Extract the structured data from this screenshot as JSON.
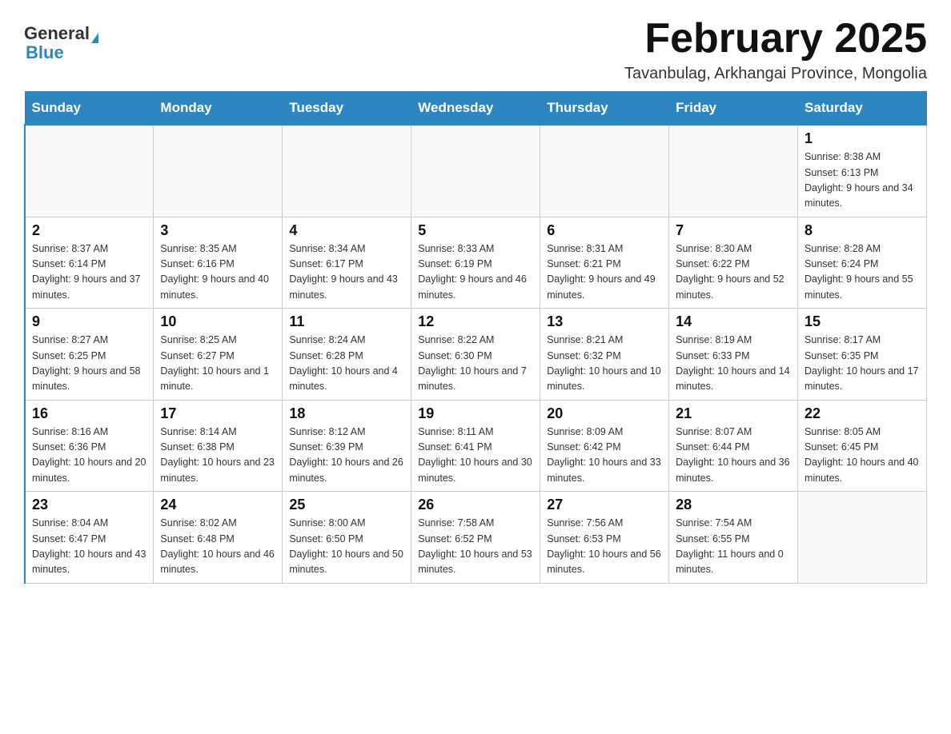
{
  "header": {
    "logo_general": "General",
    "logo_blue": "Blue",
    "title": "February 2025",
    "subtitle": "Tavanbulag, Arkhangai Province, Mongolia"
  },
  "calendar": {
    "days_of_week": [
      "Sunday",
      "Monday",
      "Tuesday",
      "Wednesday",
      "Thursday",
      "Friday",
      "Saturday"
    ],
    "weeks": [
      [
        {
          "day": "",
          "info": ""
        },
        {
          "day": "",
          "info": ""
        },
        {
          "day": "",
          "info": ""
        },
        {
          "day": "",
          "info": ""
        },
        {
          "day": "",
          "info": ""
        },
        {
          "day": "",
          "info": ""
        },
        {
          "day": "1",
          "info": "Sunrise: 8:38 AM\nSunset: 6:13 PM\nDaylight: 9 hours and 34 minutes."
        }
      ],
      [
        {
          "day": "2",
          "info": "Sunrise: 8:37 AM\nSunset: 6:14 PM\nDaylight: 9 hours and 37 minutes."
        },
        {
          "day": "3",
          "info": "Sunrise: 8:35 AM\nSunset: 6:16 PM\nDaylight: 9 hours and 40 minutes."
        },
        {
          "day": "4",
          "info": "Sunrise: 8:34 AM\nSunset: 6:17 PM\nDaylight: 9 hours and 43 minutes."
        },
        {
          "day": "5",
          "info": "Sunrise: 8:33 AM\nSunset: 6:19 PM\nDaylight: 9 hours and 46 minutes."
        },
        {
          "day": "6",
          "info": "Sunrise: 8:31 AM\nSunset: 6:21 PM\nDaylight: 9 hours and 49 minutes."
        },
        {
          "day": "7",
          "info": "Sunrise: 8:30 AM\nSunset: 6:22 PM\nDaylight: 9 hours and 52 minutes."
        },
        {
          "day": "8",
          "info": "Sunrise: 8:28 AM\nSunset: 6:24 PM\nDaylight: 9 hours and 55 minutes."
        }
      ],
      [
        {
          "day": "9",
          "info": "Sunrise: 8:27 AM\nSunset: 6:25 PM\nDaylight: 9 hours and 58 minutes."
        },
        {
          "day": "10",
          "info": "Sunrise: 8:25 AM\nSunset: 6:27 PM\nDaylight: 10 hours and 1 minute."
        },
        {
          "day": "11",
          "info": "Sunrise: 8:24 AM\nSunset: 6:28 PM\nDaylight: 10 hours and 4 minutes."
        },
        {
          "day": "12",
          "info": "Sunrise: 8:22 AM\nSunset: 6:30 PM\nDaylight: 10 hours and 7 minutes."
        },
        {
          "day": "13",
          "info": "Sunrise: 8:21 AM\nSunset: 6:32 PM\nDaylight: 10 hours and 10 minutes."
        },
        {
          "day": "14",
          "info": "Sunrise: 8:19 AM\nSunset: 6:33 PM\nDaylight: 10 hours and 14 minutes."
        },
        {
          "day": "15",
          "info": "Sunrise: 8:17 AM\nSunset: 6:35 PM\nDaylight: 10 hours and 17 minutes."
        }
      ],
      [
        {
          "day": "16",
          "info": "Sunrise: 8:16 AM\nSunset: 6:36 PM\nDaylight: 10 hours and 20 minutes."
        },
        {
          "day": "17",
          "info": "Sunrise: 8:14 AM\nSunset: 6:38 PM\nDaylight: 10 hours and 23 minutes."
        },
        {
          "day": "18",
          "info": "Sunrise: 8:12 AM\nSunset: 6:39 PM\nDaylight: 10 hours and 26 minutes."
        },
        {
          "day": "19",
          "info": "Sunrise: 8:11 AM\nSunset: 6:41 PM\nDaylight: 10 hours and 30 minutes."
        },
        {
          "day": "20",
          "info": "Sunrise: 8:09 AM\nSunset: 6:42 PM\nDaylight: 10 hours and 33 minutes."
        },
        {
          "day": "21",
          "info": "Sunrise: 8:07 AM\nSunset: 6:44 PM\nDaylight: 10 hours and 36 minutes."
        },
        {
          "day": "22",
          "info": "Sunrise: 8:05 AM\nSunset: 6:45 PM\nDaylight: 10 hours and 40 minutes."
        }
      ],
      [
        {
          "day": "23",
          "info": "Sunrise: 8:04 AM\nSunset: 6:47 PM\nDaylight: 10 hours and 43 minutes."
        },
        {
          "day": "24",
          "info": "Sunrise: 8:02 AM\nSunset: 6:48 PM\nDaylight: 10 hours and 46 minutes."
        },
        {
          "day": "25",
          "info": "Sunrise: 8:00 AM\nSunset: 6:50 PM\nDaylight: 10 hours and 50 minutes."
        },
        {
          "day": "26",
          "info": "Sunrise: 7:58 AM\nSunset: 6:52 PM\nDaylight: 10 hours and 53 minutes."
        },
        {
          "day": "27",
          "info": "Sunrise: 7:56 AM\nSunset: 6:53 PM\nDaylight: 10 hours and 56 minutes."
        },
        {
          "day": "28",
          "info": "Sunrise: 7:54 AM\nSunset: 6:55 PM\nDaylight: 11 hours and 0 minutes."
        },
        {
          "day": "",
          "info": ""
        }
      ]
    ]
  }
}
